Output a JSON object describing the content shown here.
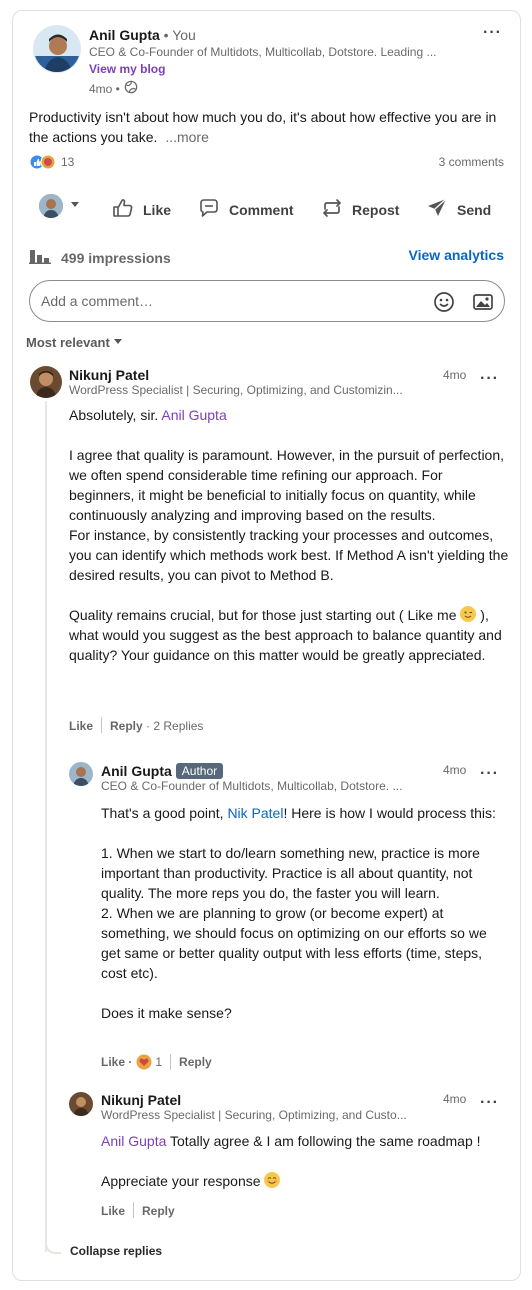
{
  "post": {
    "author_name": "Anil Gupta",
    "author_you": "• You",
    "author_headline": "CEO & Co-Founder of Multidots, Multicollab, Dotstore. Leading ...",
    "view_blog": "View my blog",
    "age": "4mo •",
    "text": "Productivity isn't about how much you do, it's about how effective you are in the actions you take.",
    "more": "...more",
    "reactions_count": "13",
    "comments_count": "3 comments"
  },
  "actions": {
    "like": "Like",
    "comment": "Comment",
    "repost": "Repost",
    "send": "Send"
  },
  "analytics": {
    "impressions": "499 impressions",
    "view_analytics": "View analytics"
  },
  "composer": {
    "placeholder": "Add a comment…"
  },
  "sort": {
    "label": "Most relevant"
  },
  "comments": [
    {
      "name": "Nikunj Patel",
      "headline": "WordPress Specialist | Securing, Optimizing, and Customizin...",
      "age": "4mo",
      "body_intro": "Absolutely, sir.",
      "mention": "Anil Gupta",
      "para1": "I agree that quality is paramount. However, in the pursuit of perfection, we often spend considerable time refining our approach. For beginners, it might be beneficial to initially focus on quantity, while continuously analyzing and improving based on the results.",
      "para2": "For instance, by consistently tracking your processes and outcomes, you can identify which methods work best. If Method A isn't yielding the desired results, you can pivot to Method B.",
      "para3a": "Quality remains crucial, but for those just starting out ( Like me",
      "para3b": "), what would you suggest as the best approach to balance quantity and quality? Your guidance on this matter would be greatly appreciated.",
      "like": "Like",
      "reply": "Reply",
      "replies": "· 2 Replies"
    }
  ],
  "replies": [
    {
      "name": "Anil Gupta",
      "badge": "Author",
      "headline": "CEO & Co-Founder of Multidots, Multicollab, Dotstore. ...",
      "age": "4mo",
      "intro_a": "That's a good point,",
      "mention": "Nik Patel",
      "intro_b": "! Here is how I would process this:",
      "point1": "1. When we start to do/learn something new, practice is more important than productivity. Practice is all about quantity, not quality. The more reps you do, the faster you will learn.",
      "point2": "2. When we are planning to grow (or become expert) at something, we should focus on optimizing on our efforts so we get same or better quality output with less efforts (time, steps, cost etc).",
      "closing": "Does it make sense?",
      "like": "Like ·",
      "reaction_count": "1",
      "reply": "Reply"
    },
    {
      "name": "Nikunj Patel",
      "headline": "WordPress Specialist | Securing, Optimizing, and Custo...",
      "age": "4mo",
      "mention": "Anil Gupta",
      "line1": "Totally agree & I am following the same roadmap !",
      "line2": "Appreciate your response",
      "like": "Like",
      "reply": "Reply"
    }
  ],
  "collapse": "Collapse replies",
  "colors": {
    "link_blue": "#0a66c2",
    "mention_purple": "#7b3fb8",
    "author_badge": "#56687a"
  }
}
